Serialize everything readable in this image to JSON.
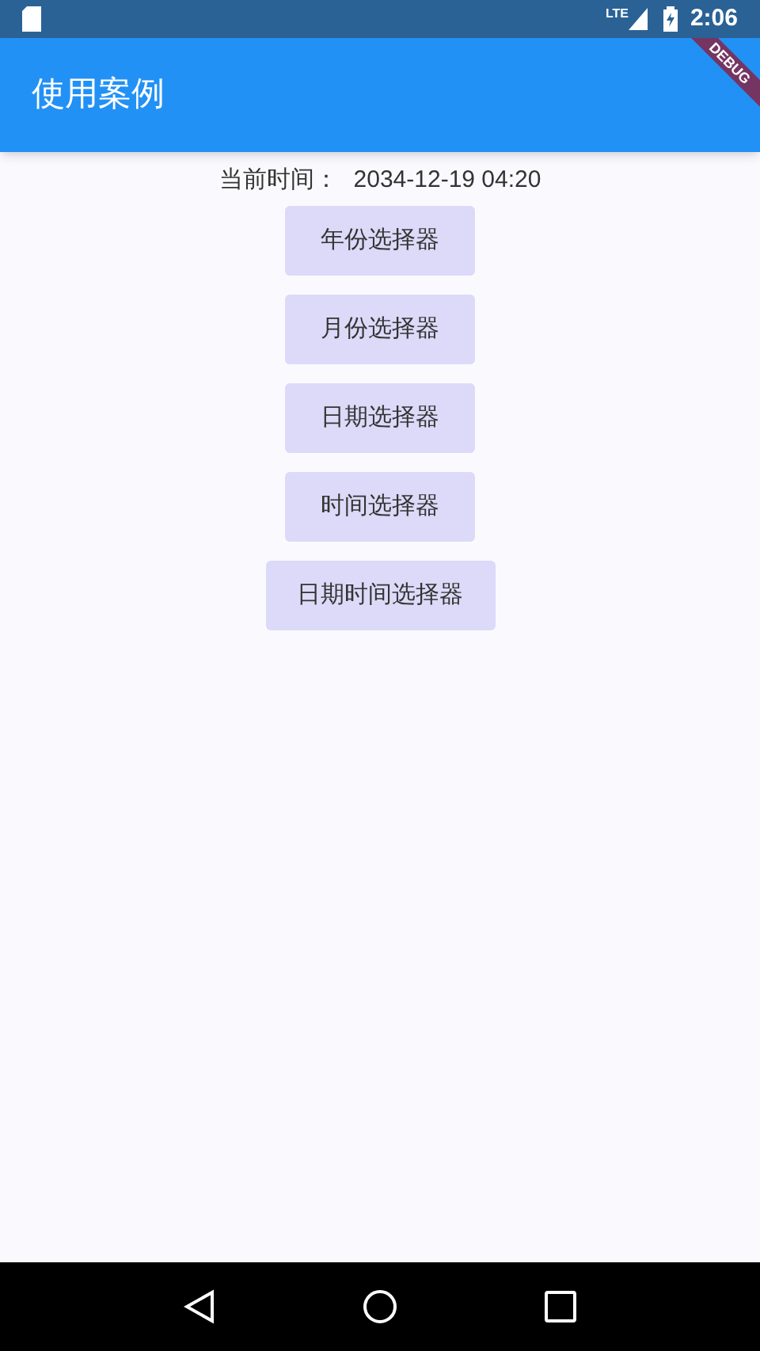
{
  "status_bar": {
    "time": "2:06",
    "network": "LTE"
  },
  "app_bar": {
    "title": "使用案例"
  },
  "debug_banner": {
    "label": "DEBUG"
  },
  "current_time": {
    "label": "当前时间：",
    "value": "2034-12-19 04:20"
  },
  "buttons": [
    {
      "label": "年份选择器"
    },
    {
      "label": "月份选择器"
    },
    {
      "label": "日期选择器"
    },
    {
      "label": "时间选择器"
    },
    {
      "label": "日期时间选择器"
    }
  ]
}
